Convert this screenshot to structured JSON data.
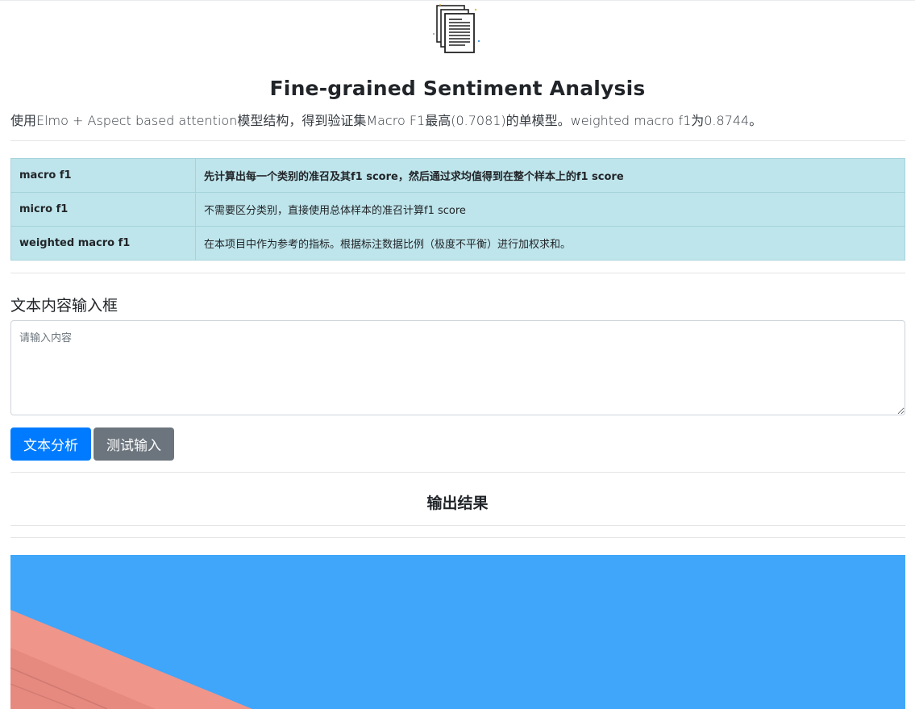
{
  "header": {
    "logo_icon": "document-stack-icon",
    "title": "Fine-grained Sentiment Analysis",
    "subtitle": "使用Elmo + Aspect based attention模型结构，得到验证集Macro F1最高(0.7081)的单模型。weighted macro f1为0.8744。"
  },
  "metrics_table": {
    "background_color": "#bee5eb",
    "rows": [
      {
        "name": "macro f1",
        "description": "先计算出每一个类别的准召及其f1 score，然后通过求均值得到在整个样本上的f1 score"
      },
      {
        "name": "micro f1",
        "description": "不需要区分类别，直接使用总体样本的准召计算f1 score"
      },
      {
        "name": "weighted macro f1",
        "description": "在本项目中作为参考的指标。根据标注数据比例（极度不平衡）进行加权求和。"
      }
    ]
  },
  "input_section": {
    "label": "文本内容输入框",
    "placeholder": "请输入内容",
    "value": ""
  },
  "buttons": {
    "analyze_label": "文本分析",
    "test_label": "测试输入",
    "primary_color": "#007bff",
    "secondary_color": "#6c757d"
  },
  "output": {
    "heading": "输出结果",
    "image_colors": {
      "sky": "#3fa6fa",
      "band": "#f0958a"
    }
  }
}
